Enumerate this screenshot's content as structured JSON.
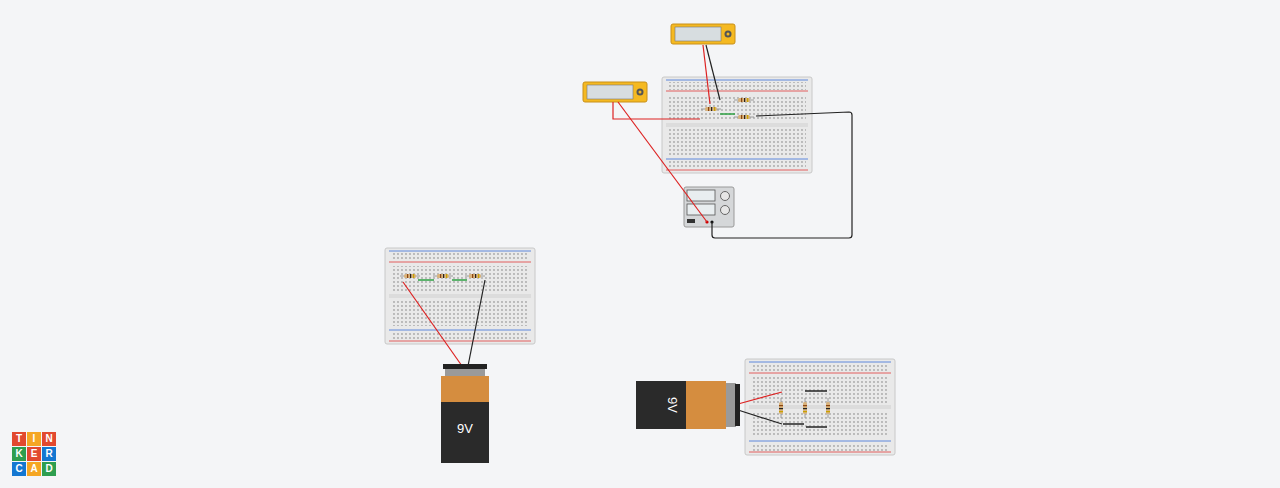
{
  "canvas": {
    "logo": {
      "letters": [
        {
          "char": "T",
          "color": "#e2492f"
        },
        {
          "char": "I",
          "color": "#f5a623"
        },
        {
          "char": "N",
          "color": "#e2492f"
        },
        {
          "char": "K",
          "color": "#2e9e4f"
        },
        {
          "char": "E",
          "color": "#e2492f"
        },
        {
          "char": "R",
          "color": "#1477d1"
        },
        {
          "char": "C",
          "color": "#1477d1"
        },
        {
          "char": "A",
          "color": "#f5a623"
        },
        {
          "char": "D",
          "color": "#2e9e4f"
        }
      ]
    },
    "batteries": [
      {
        "label": "9V",
        "kind": "upright"
      },
      {
        "label": "9V",
        "kind": "sideways"
      }
    ]
  }
}
